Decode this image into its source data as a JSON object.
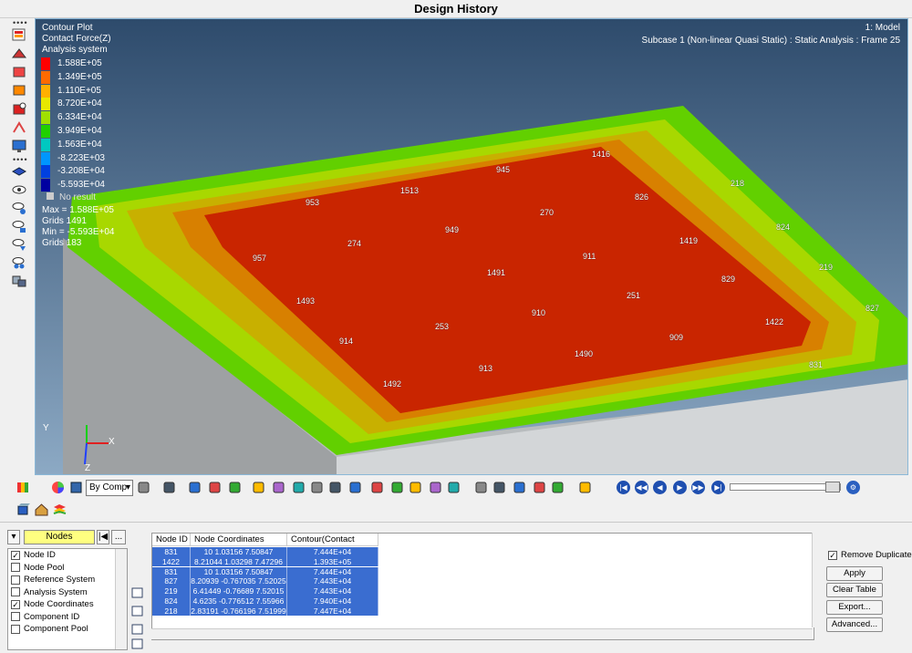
{
  "window": {
    "title": "Design History"
  },
  "viewport": {
    "top_left": [
      "Contour Plot",
      "Contact Force(Z)",
      "Analysis system"
    ],
    "top_right": [
      "1: Model",
      "Subcase 1 (Non-linear Quasi Static) : Static Analysis : Frame 25"
    ],
    "legend": [
      {
        "value": "1.588E+05",
        "color": "#ff0000"
      },
      {
        "value": "1.349E+05",
        "color": "#ff6a00"
      },
      {
        "value": "1.110E+05",
        "color": "#ffb000"
      },
      {
        "value": "8.720E+04",
        "color": "#e8e800"
      },
      {
        "value": "6.334E+04",
        "color": "#a0e000"
      },
      {
        "value": "3.949E+04",
        "color": "#20d000"
      },
      {
        "value": "1.563E+04",
        "color": "#00c8c0"
      },
      {
        "value": "-8.223E+03",
        "color": "#0096ff"
      },
      {
        "value": "-3.208E+04",
        "color": "#0040e0"
      },
      {
        "value": "-5.593E+04",
        "color": "#0000a0"
      }
    ],
    "no_result": "No result",
    "stats": [
      "Max = 1.588E+05",
      "Grids 1491",
      "Min = -5.593E+04",
      "Grids 183"
    ],
    "axis": {
      "y": "Y",
      "x": "X",
      "z": "Z"
    },
    "node_labels": [
      "1416",
      "945",
      "1513",
      "826",
      "218",
      "953",
      "270",
      "949",
      "1419",
      "824",
      "274",
      "911",
      "219",
      "957",
      "1491",
      "829",
      "251",
      "827",
      "1493",
      "910",
      "1422",
      "253",
      "909",
      "914",
      "1490",
      "913",
      "831",
      "1492"
    ]
  },
  "toolbar": {
    "by_comp": "By Comp"
  },
  "bottom": {
    "entity_selector": "Nodes",
    "checklist": [
      {
        "label": "Node ID",
        "checked": true
      },
      {
        "label": "Node Pool",
        "checked": false
      },
      {
        "label": "Reference System",
        "checked": false
      },
      {
        "label": "Analysis System",
        "checked": false
      },
      {
        "label": "Node Coordinates",
        "checked": true
      },
      {
        "label": "Component ID",
        "checked": false
      },
      {
        "label": "Component Pool",
        "checked": false
      }
    ],
    "table": {
      "headers": [
        "Node ID",
        "Node Coordinates",
        "Contour(Contact Force)"
      ],
      "rows": [
        [
          "831",
          "10 1.03156 7.50847",
          "7.444E+04"
        ],
        [
          "1422",
          "8.21044 1.03298 7.47296",
          "1.393E+05"
        ],
        [
          "831",
          "10 1.03156 7.50847",
          "7.444E+04"
        ],
        [
          "827",
          "8.20939 -0.767035 7.52025",
          "7.443E+04"
        ],
        [
          "219",
          "6.41449 -0.76689 7.52015",
          "7.443E+04"
        ],
        [
          "824",
          "4.6235 -0.776512 7.55966",
          "7.940E+04"
        ],
        [
          "218",
          "2.83191 -0.766196 7.51999",
          "7.447E+04"
        ]
      ]
    },
    "remove_duplicates": {
      "label": "Remove Duplicates",
      "checked": true
    },
    "buttons": {
      "apply": "Apply",
      "clear_table": "Clear Table",
      "export": "Export...",
      "advanced": "Advanced..."
    },
    "more": "..."
  }
}
